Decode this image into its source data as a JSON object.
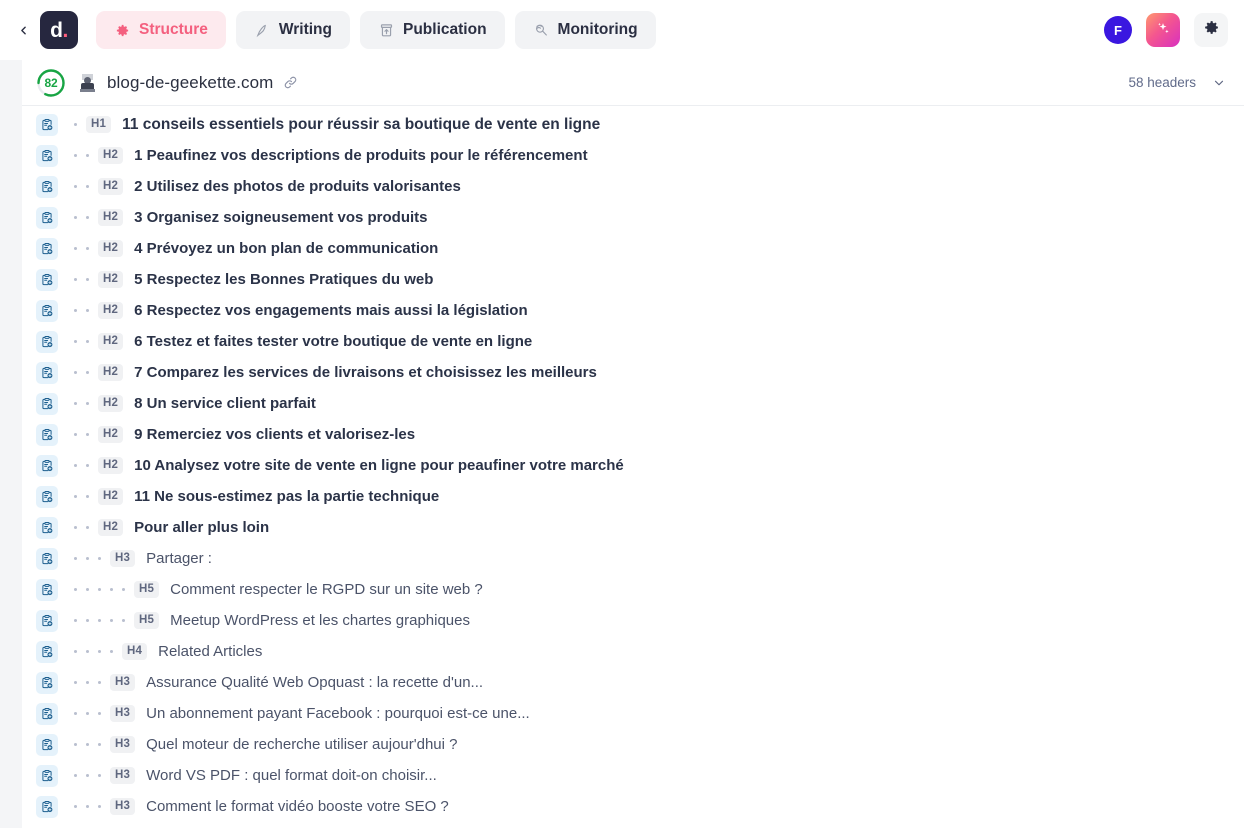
{
  "topbar": {
    "back_icon": "chevron-left-icon",
    "logo_text": "d",
    "logo_dot": ".",
    "tabs": [
      {
        "label": "Structure",
        "icon": "gear-icon",
        "active": true
      },
      {
        "label": "Writing",
        "icon": "pen-icon",
        "active": false
      },
      {
        "label": "Publication",
        "icon": "package-up-icon",
        "active": false
      },
      {
        "label": "Monitoring",
        "icon": "radar-icon",
        "active": false
      }
    ],
    "avatar_initial": "F",
    "ai_icon": "sparkles-icon",
    "settings_icon": "gear-icon",
    "accent_active_bg": "#fdeaee",
    "accent_active_fg": "#f4607f",
    "avatar_color": "#3a17e0"
  },
  "site": {
    "score": "82",
    "score_color": "#18a544",
    "score_pct": 82,
    "favicon": "site-favicon",
    "url": "blog-de-geekette.com",
    "link_icon": "link-icon",
    "headers_count": "58 headers",
    "collapse_icon": "chevron-down-icon"
  },
  "list": {
    "row_icon": "add-to-brief-icon",
    "rows": [
      {
        "level": "H1",
        "depth": 1,
        "title": "11 conseils essentiels pour réussir sa boutique de vente en ligne",
        "style": "h1"
      },
      {
        "level": "H2",
        "depth": 2,
        "title": "1 Peaufinez vos descriptions de produits pour le référencement",
        "style": "bold"
      },
      {
        "level": "H2",
        "depth": 2,
        "title": "2 Utilisez des photos de produits valorisantes",
        "style": "bold"
      },
      {
        "level": "H2",
        "depth": 2,
        "title": "3 Organisez soigneusement vos produits",
        "style": "bold"
      },
      {
        "level": "H2",
        "depth": 2,
        "title": "4 Prévoyez un bon plan de communication",
        "style": "bold"
      },
      {
        "level": "H2",
        "depth": 2,
        "title": "5 Respectez les Bonnes Pratiques du web",
        "style": "bold"
      },
      {
        "level": "H2",
        "depth": 2,
        "title": "6 Respectez vos engagements mais aussi la législation",
        "style": "bold"
      },
      {
        "level": "H2",
        "depth": 2,
        "title": "6 Testez et faites tester votre boutique de vente en ligne",
        "style": "bold"
      },
      {
        "level": "H2",
        "depth": 2,
        "title": "7 Comparez les services de livraisons et choisissez les meilleurs",
        "style": "bold"
      },
      {
        "level": "H2",
        "depth": 2,
        "title": "8 Un service client parfait",
        "style": "bold"
      },
      {
        "level": "H2",
        "depth": 2,
        "title": "9 Remerciez vos clients et valorisez-les",
        "style": "bold"
      },
      {
        "level": "H2",
        "depth": 2,
        "title": "10 Analysez votre site de vente en ligne pour peaufiner votre marché",
        "style": "bold"
      },
      {
        "level": "H2",
        "depth": 2,
        "title": "11 Ne sous-estimez pas la partie technique",
        "style": "bold"
      },
      {
        "level": "H2",
        "depth": 2,
        "title": "Pour aller plus loin",
        "style": "bold"
      },
      {
        "level": "H3",
        "depth": 3,
        "title": "Partager :",
        "style": "light"
      },
      {
        "level": "H5",
        "depth": 5,
        "title": "Comment respecter le RGPD sur un site web ?",
        "style": "light"
      },
      {
        "level": "H5",
        "depth": 5,
        "title": "Meetup WordPress et les chartes graphiques",
        "style": "light"
      },
      {
        "level": "H4",
        "depth": 4,
        "title": "Related Articles",
        "style": "light"
      },
      {
        "level": "H3",
        "depth": 3,
        "title": "Assurance Qualité Web Opquast : la recette d'un...",
        "style": "light"
      },
      {
        "level": "H3",
        "depth": 3,
        "title": "Un abonnement payant Facebook : pourquoi est-ce une...",
        "style": "light"
      },
      {
        "level": "H3",
        "depth": 3,
        "title": "Quel moteur de recherche utiliser aujour'dhui ?",
        "style": "light"
      },
      {
        "level": "H3",
        "depth": 3,
        "title": "Word VS PDF : quel format doit-on choisir...",
        "style": "light"
      },
      {
        "level": "H3",
        "depth": 3,
        "title": "Comment le format vidéo booste votre SEO ?",
        "style": "light"
      }
    ]
  }
}
